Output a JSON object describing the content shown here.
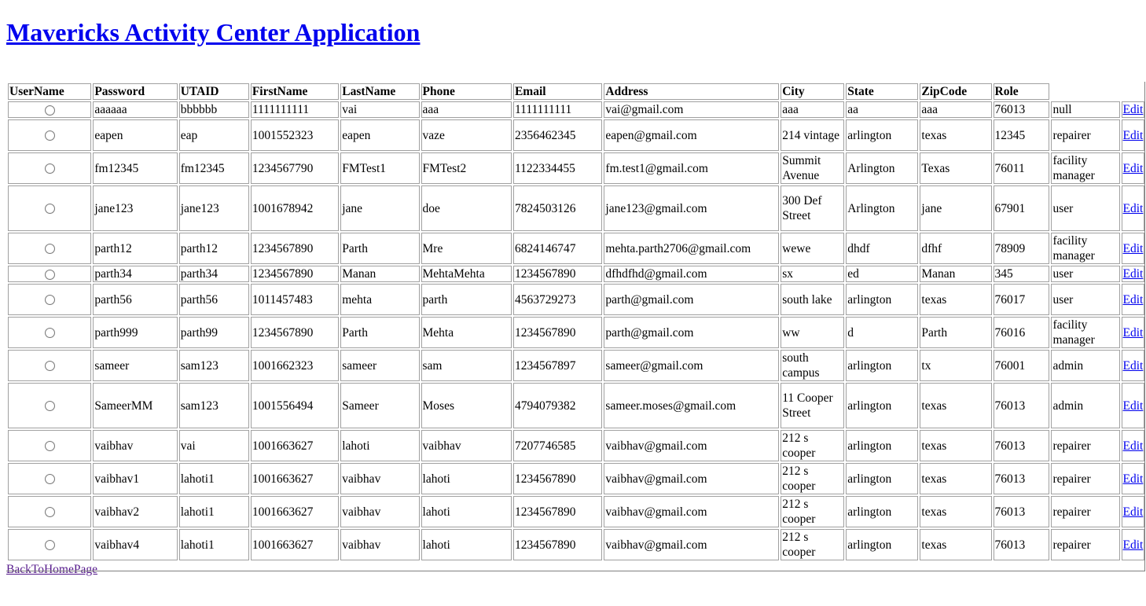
{
  "page": {
    "title": "Mavericks Activity Center Application",
    "back_link": "BackToHomePage"
  },
  "table": {
    "headers": [
      "UserName",
      "Password",
      "UTAID",
      "FirstName",
      "LastName",
      "Phone",
      "Email",
      "Address",
      "City",
      "State",
      "ZipCode",
      "Role"
    ],
    "edit_label": "Edit",
    "rows": [
      [
        "aaaaaa",
        "bbbbbb",
        "1111111111",
        "vai",
        "aaa",
        "1111111111",
        "vai@gmail.com",
        "aaa",
        "aa",
        "aaa",
        "76013",
        "null"
      ],
      [
        "eapen",
        "eap",
        "1001552323",
        "eapen",
        "vaze",
        "2356462345",
        "eapen@gmail.com",
        "214 vintage",
        "arlington",
        "texas",
        "12345",
        "repairer"
      ],
      [
        "fm12345",
        "fm12345",
        "1234567790",
        "FMTest1",
        "FMTest2",
        "1122334455",
        "fm.test1@gmail.com",
        "Summit Avenue",
        "Arlington",
        "Texas",
        "76011",
        "facility manager"
      ],
      [
        "jane123",
        "jane123",
        "1001678942",
        "jane",
        "doe",
        "7824503126",
        "jane123@gmail.com",
        "300 Def Street",
        "Arlington",
        "jane",
        "67901",
        "user"
      ],
      [
        "parth12",
        "parth12",
        "1234567890",
        "Parth",
        "Mre",
        "6824146747",
        "mehta.parth2706@gmail.com",
        "wewe",
        "dhdf",
        "dfhf",
        "78909",
        "facility manager"
      ],
      [
        "parth34",
        "parth34",
        "1234567890",
        "Manan",
        "MehtaMehta",
        "1234567890",
        "dfhdfhd@gmail.com",
        "sx",
        "ed",
        "Manan",
        "345",
        "user"
      ],
      [
        "parth56",
        "parth56",
        "1011457483",
        "mehta",
        "parth",
        "4563729273",
        "parth@gmail.com",
        "south lake",
        "arlington",
        "texas",
        "76017",
        "user"
      ],
      [
        "parth999",
        "parth99",
        "1234567890",
        "Parth",
        "Mehta",
        "1234567890",
        "parth@gmail.com",
        "ww",
        "d",
        "Parth",
        "76016",
        "facility manager"
      ],
      [
        "sameer",
        "sam123",
        "1001662323",
        "sameer",
        "sam",
        "1234567897",
        "sameer@gmail.com",
        "south campus",
        "arlington",
        "tx",
        "76001",
        "admin"
      ],
      [
        "SameerMM",
        "sam123",
        "1001556494",
        "Sameer",
        "Moses",
        "4794079382",
        "sameer.moses@gmail.com",
        "11 Cooper Street",
        "arlington",
        "texas",
        "76013",
        "admin"
      ],
      [
        "vaibhav",
        "vai",
        "1001663627",
        "lahoti",
        "vaibhav",
        "7207746585",
        "vaibhav@gmail.com",
        "212 s cooper",
        "arlington",
        "texas",
        "76013",
        "repairer"
      ],
      [
        "vaibhav1",
        "lahoti1",
        "1001663627",
        "vaibhav",
        "lahoti",
        "1234567890",
        "vaibhav@gmail.com",
        "212 s cooper",
        "arlington",
        "texas",
        "76013",
        "repairer"
      ],
      [
        "vaibhav2",
        "lahoti1",
        "1001663627",
        "vaibhav",
        "lahoti",
        "1234567890",
        "vaibhav@gmail.com",
        "212 s cooper",
        "arlington",
        "texas",
        "76013",
        "repairer"
      ],
      [
        "vaibhav4",
        "lahoti1",
        "1001663627",
        "vaibhav",
        "lahoti",
        "1234567890",
        "vaibhav@gmail.com",
        "212 s cooper",
        "arlington",
        "texas",
        "76013",
        "repairer"
      ]
    ]
  }
}
